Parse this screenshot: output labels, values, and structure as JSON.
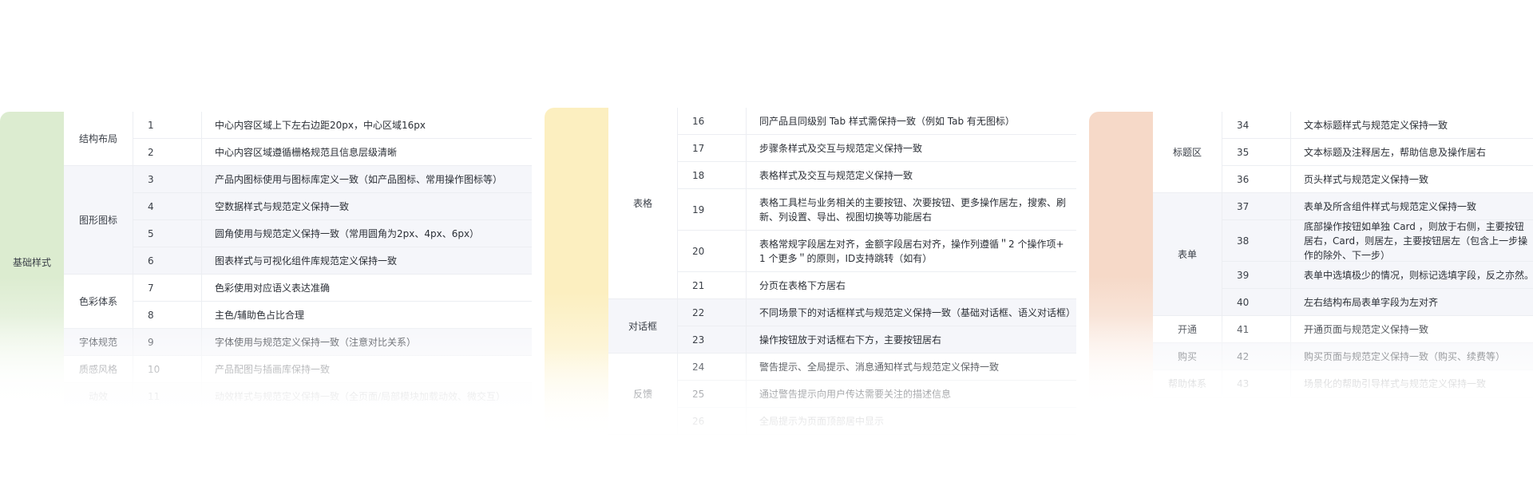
{
  "panels": [
    {
      "strip_label": "基础样式",
      "strip_color": "#dcecd0",
      "groups": [
        {
          "name": "结构布局",
          "rows": 2
        },
        {
          "name": "图形图标",
          "rows": 4
        },
        {
          "name": "色彩体系",
          "rows": 2
        },
        {
          "name": "字体规范",
          "rows": 1
        },
        {
          "name": "质感风格",
          "rows": 1
        },
        {
          "name": "动效",
          "rows": 1
        }
      ],
      "items": [
        {
          "num": "1",
          "text": "中心内容区域上下左右边距20px，中心区域16px"
        },
        {
          "num": "2",
          "text": "中心内容区域遵循栅格规范且信息层级清晰"
        },
        {
          "num": "3",
          "text": "产品内图标使用与图标库定义一致（如产品图标、常用操作图标等）"
        },
        {
          "num": "4",
          "text": "空数据样式与规范定义保持一致"
        },
        {
          "num": "5",
          "text": "圆角使用与规范定义保持一致（常用圆角为2px、4px、6px）"
        },
        {
          "num": "6",
          "text": "图表样式与可视化组件库规范定义保持一致"
        },
        {
          "num": "7",
          "text": "色彩使用对应语义表达准确"
        },
        {
          "num": "8",
          "text": "主色/辅助色占比合理"
        },
        {
          "num": "9",
          "text": "字体使用与规范定义保持一致（注意对比关系）"
        },
        {
          "num": "10",
          "text": "产品配图与插画库保持一致"
        },
        {
          "num": "11",
          "text": "动效样式与规范定义保持一致（全页面/局部模块加载动效、微交互）"
        }
      ]
    },
    {
      "strip_label": "",
      "strip_color": "#fcefc0",
      "groups": [
        {
          "name": "表格",
          "rows": 6
        },
        {
          "name": "对话框",
          "rows": 2
        },
        {
          "name": "反馈",
          "rows": 3
        }
      ],
      "items": [
        {
          "num": "16",
          "text": "同产品且同级别 Tab 样式需保持一致（例如 Tab 有无图标）"
        },
        {
          "num": "17",
          "text": "步骤条样式及交互与规范定义保持一致"
        },
        {
          "num": "18",
          "text": "表格样式及交互与规范定义保持一致"
        },
        {
          "num": "19",
          "text": "表格工具栏与业务相关的主要按钮、次要按钮、更多操作居左，搜索、刷新、列设置、导出、视图切换等功能居右",
          "tall": true
        },
        {
          "num": "20",
          "text": "表格常规字段居左对齐，金额字段居右对齐，操作列遵循＂2 个操作项+ 1 个更多＂的原则，ID支持跳转（如有）",
          "tall": true
        },
        {
          "num": "21",
          "text": "分页在表格下方居右"
        },
        {
          "num": "22",
          "text": "不同场景下的对话框样式与规范定义保持一致（基础对话框、语义对话框）"
        },
        {
          "num": "23",
          "text": "操作按钮放于对话框右下方，主要按钮居右"
        },
        {
          "num": "24",
          "text": "警告提示、全局提示、消息通知样式与规范定义保持一致"
        },
        {
          "num": "25",
          "text": "通过警告提示向用户传达需要关注的描述信息"
        },
        {
          "num": "26",
          "text": "全局提示为页面顶部居中显示"
        }
      ]
    },
    {
      "strip_label": "",
      "strip_color": "#f6d9c8",
      "groups": [
        {
          "name": "标题区",
          "rows": 3
        },
        {
          "name": "表单",
          "rows": 4
        },
        {
          "name": "开通",
          "rows": 1
        },
        {
          "name": "购买",
          "rows": 1
        },
        {
          "name": "帮助体系",
          "rows": 1
        }
      ],
      "items": [
        {
          "num": "34",
          "text": "文本标题样式与规范定义保持一致"
        },
        {
          "num": "35",
          "text": "文本标题及注释居左，帮助信息及操作居右"
        },
        {
          "num": "36",
          "text": "页头样式与规范定义保持一致"
        },
        {
          "num": "37",
          "text": "表单及所含组件样式与规范定义保持一致"
        },
        {
          "num": "38",
          "text": "底部操作按钮如单独 Card ，则放于右侧，主要按钮居右，Card，则居左，主要按钮居左（包含上一步操作的除外、下一步）",
          "tall": true
        },
        {
          "num": "39",
          "text": "表单中选填极少的情况，则标记选填字段，反之亦然。"
        },
        {
          "num": "40",
          "text": "左右结构布局表单字段为左对齐"
        },
        {
          "num": "41",
          "text": "开通页面与规范定义保持一致"
        },
        {
          "num": "42",
          "text": "购买页面与规范定义保持一致（购买、续费等）"
        },
        {
          "num": "43",
          "text": "场景化的帮助引导样式与规范定义保持一致"
        }
      ]
    }
  ]
}
